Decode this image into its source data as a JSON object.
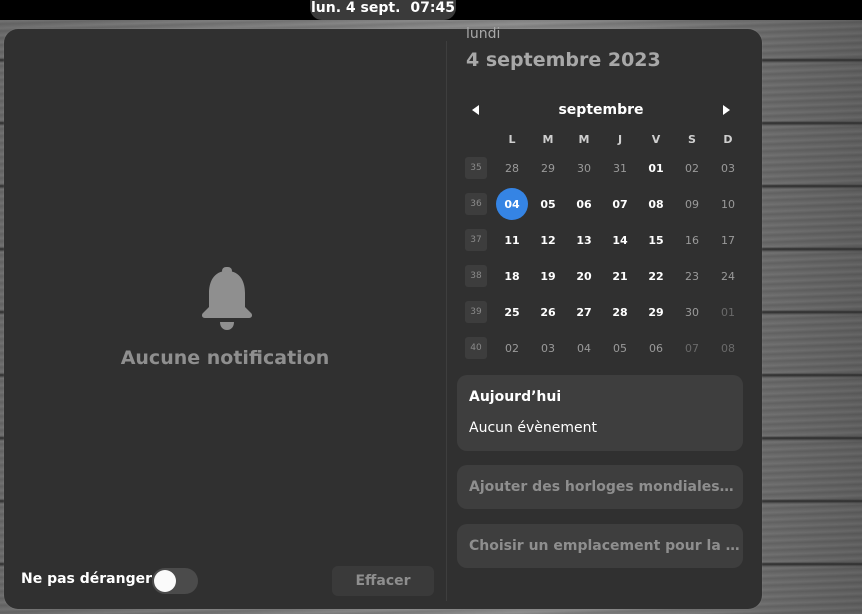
{
  "topbar": {
    "date": "lun. 4 sept.",
    "time": "07:45"
  },
  "notifications": {
    "empty_text": "Aucune notification",
    "dnd_label": "Ne pas déranger",
    "dnd_enabled": false,
    "clear_label": "Effacer"
  },
  "calendar": {
    "weekday_long": "lundi",
    "date_long": "4 septembre 2023",
    "month_name": "septembre",
    "weekday_headers": [
      "L",
      "M",
      "M",
      "J",
      "V",
      "S",
      "D"
    ],
    "weeks": [
      {
        "num": "35",
        "days": [
          "28",
          "29",
          "30",
          "31",
          "01",
          "02",
          "03"
        ]
      },
      {
        "num": "36",
        "days": [
          "04",
          "05",
          "06",
          "07",
          "08",
          "09",
          "10"
        ]
      },
      {
        "num": "37",
        "days": [
          "11",
          "12",
          "13",
          "14",
          "15",
          "16",
          "17"
        ]
      },
      {
        "num": "38",
        "days": [
          "18",
          "19",
          "20",
          "21",
          "22",
          "23",
          "24"
        ]
      },
      {
        "num": "39",
        "days": [
          "25",
          "26",
          "27",
          "28",
          "29",
          "30",
          "01"
        ]
      },
      {
        "num": "40",
        "days": [
          "02",
          "03",
          "04",
          "05",
          "06",
          "07",
          "08"
        ]
      }
    ],
    "today": "04"
  },
  "events": {
    "title": "Aujourd’hui",
    "empty_text": "Aucun évènement"
  },
  "world_clocks": {
    "label": "Ajouter des horloges mondiales…"
  },
  "weather": {
    "label": "Choisir un emplacement pour la …"
  },
  "colors": {
    "accent": "#3584e4",
    "panel": "#303030",
    "card": "#3e3e3e"
  }
}
